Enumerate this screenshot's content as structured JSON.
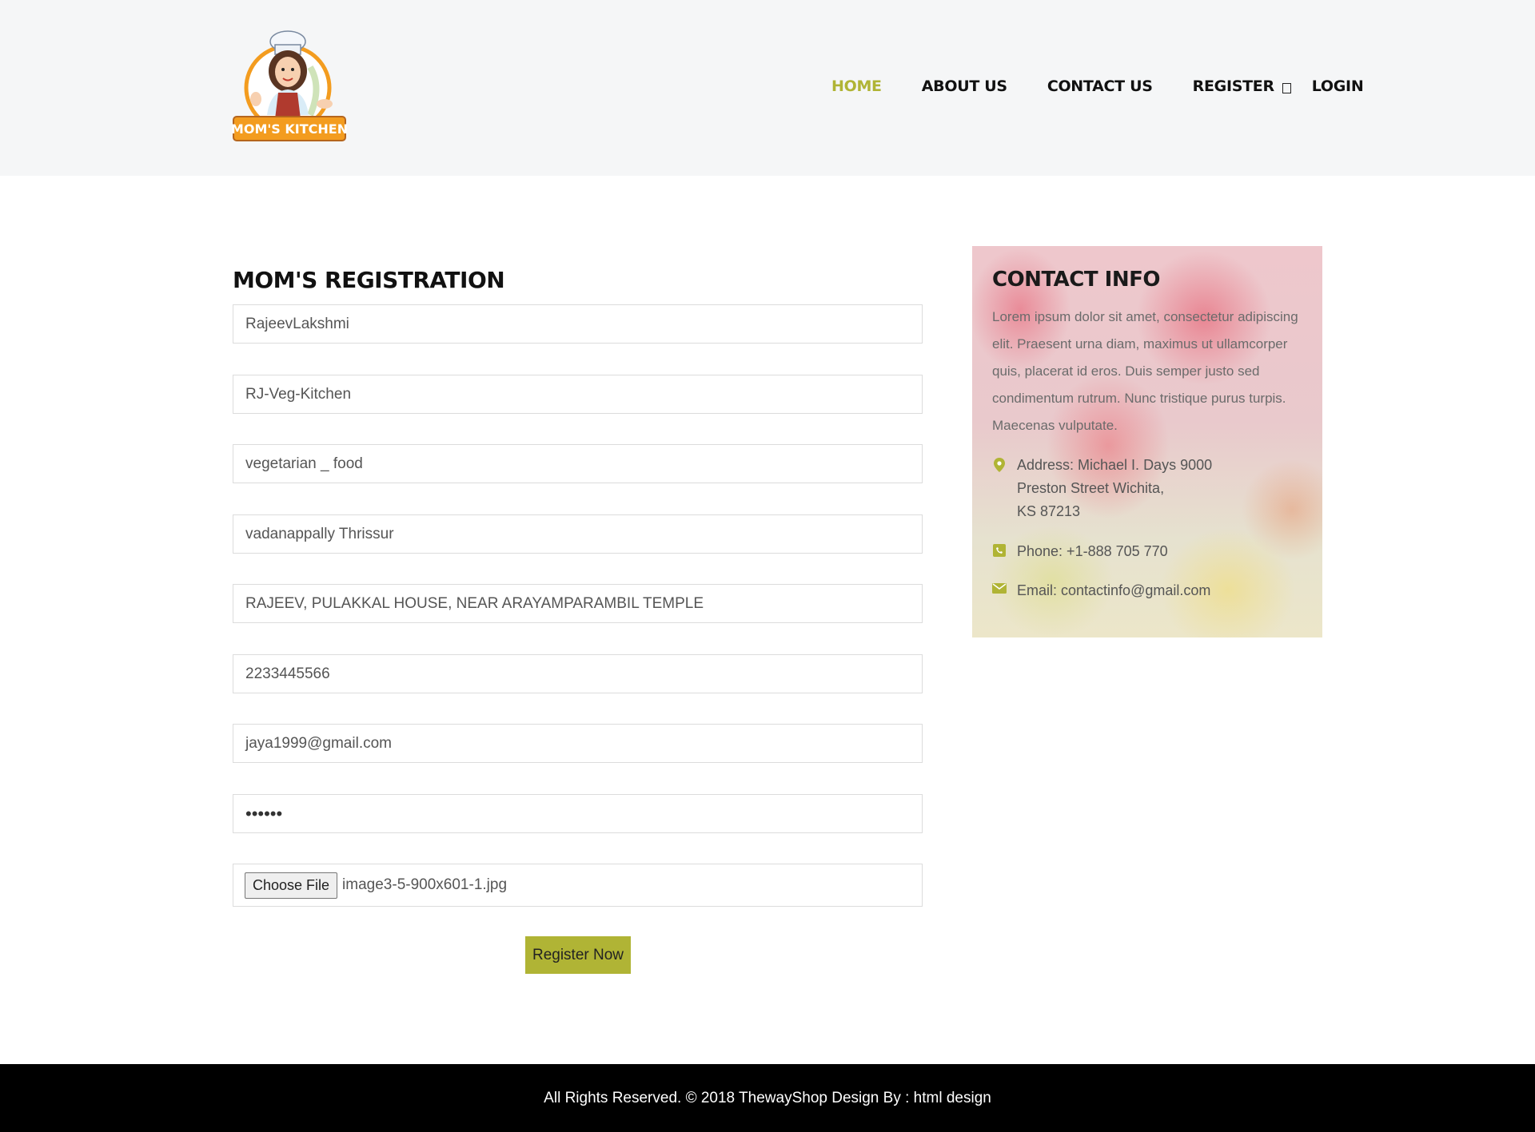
{
  "brand": {
    "logo_text": "MOM'S KITCHEN"
  },
  "nav": {
    "home": "HOME",
    "about": "ABOUT US",
    "contact": "CONTACT US",
    "register": "REGISTER",
    "register_icon": "sign-in-icon",
    "login": "LOGIN"
  },
  "form": {
    "title": "MOM'S REGISTRATION",
    "fields": [
      "RajeevLakshmi",
      "RJ-Veg-Kitchen",
      "vegetarian _ food",
      "vadanappally  Thrissur",
      "RAJEEV, PULAKKAL HOUSE, NEAR ARAYAMPARAMBIL TEMPLE",
      "2233445566",
      "jaya1999@gmail.com"
    ],
    "password_mask": "••••••",
    "file_button": "Choose File",
    "file_name": "image3-5-900x601-1.jpg",
    "submit": "Register Now"
  },
  "contact": {
    "title": "CONTACT INFO",
    "description": "Lorem ipsum dolor sit amet, consectetur adipiscing elit. Praesent urna diam, maximus ut ullamcorper quis, placerat id eros. Duis semper justo sed condimentum rutrum. Nunc tristique purus turpis. Maecenas vulputate.",
    "address_line1": "Address: Michael I. Days 9000",
    "address_line2": "Preston Street Wichita,",
    "address_line3": "KS 87213",
    "phone": "Phone: +1-888 705 770",
    "email": "Email: contactinfo@gmail.com",
    "accent_color": "#b0b435"
  },
  "footer": {
    "text": "All Rights Reserved. © 2018 ThewayShop Design By : html design"
  }
}
